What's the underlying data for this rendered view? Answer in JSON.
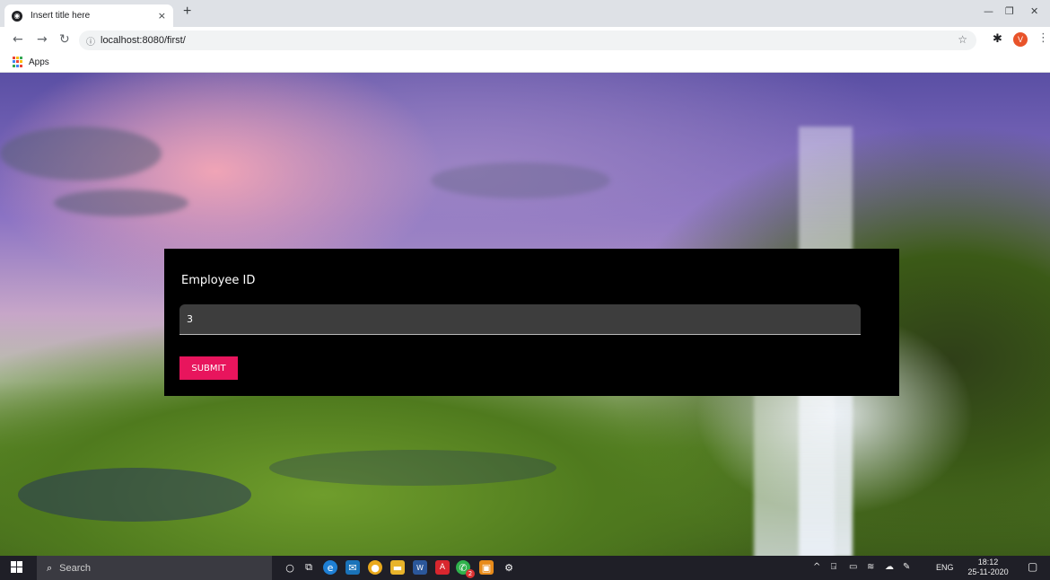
{
  "browser": {
    "tab_title": "Insert title here",
    "tab_close": "×",
    "new_tab": "+",
    "url": "localhost:8080/first/",
    "bookmarks": {
      "apps_label": "Apps"
    },
    "avatar_letter": "V"
  },
  "form": {
    "label": "Employee ID",
    "value": "3",
    "submit_label": "SUBMIT",
    "accent_color": "#e8155d"
  },
  "taskbar": {
    "search_placeholder": "Search",
    "language": "ENG",
    "time": "18:12",
    "date": "25-11-2020",
    "badge_count": "2"
  }
}
